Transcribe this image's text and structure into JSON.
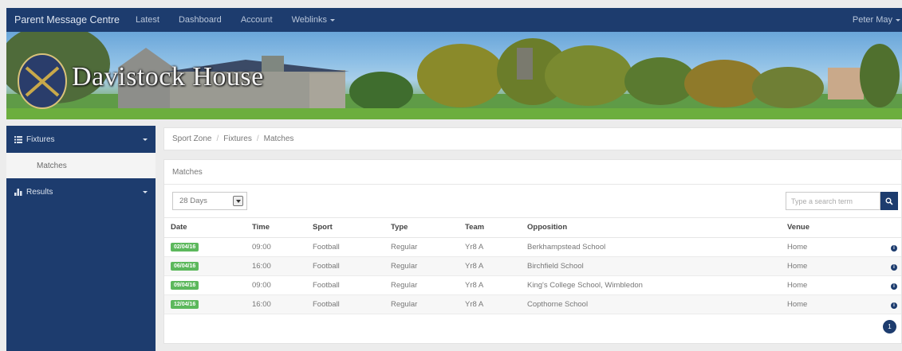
{
  "navbar": {
    "brand": "Parent Message Centre",
    "links": [
      "Latest",
      "Dashboard",
      "Account",
      "Weblinks"
    ],
    "user": "Peter May"
  },
  "banner": {
    "school_name": "Davistock House"
  },
  "sidebar": {
    "items": [
      {
        "label": "Fixtures",
        "icon": "list-icon",
        "expanded": true,
        "subitems": [
          "Matches"
        ]
      },
      {
        "label": "Results",
        "icon": "bar-chart-icon",
        "expanded": false
      }
    ]
  },
  "breadcrumb": [
    "Sport Zone",
    "Fixtures",
    "Matches"
  ],
  "panel": {
    "title": "Matches",
    "range_select": "28 Days",
    "search_placeholder": "Type a search term",
    "columns": [
      "Date",
      "Time",
      "Sport",
      "Type",
      "Team",
      "Opposition",
      "Venue"
    ],
    "rows": [
      {
        "date": "02/04/16",
        "time": "09:00",
        "sport": "Football",
        "type": "Regular",
        "team": "Yr8 A",
        "opposition": "Berkhampstead School",
        "venue": "Home"
      },
      {
        "date": "06/04/16",
        "time": "16:00",
        "sport": "Football",
        "type": "Regular",
        "team": "Yr8 A",
        "opposition": "Birchfield School",
        "venue": "Home"
      },
      {
        "date": "09/04/16",
        "time": "09:00",
        "sport": "Football",
        "type": "Regular",
        "team": "Yr8 A",
        "opposition": "King's College School, Wimbledon",
        "venue": "Home"
      },
      {
        "date": "12/04/16",
        "time": "16:00",
        "sport": "Football",
        "type": "Regular",
        "team": "Yr8 A",
        "opposition": "Copthorne School",
        "venue": "Home"
      }
    ],
    "page": "1"
  },
  "colors": {
    "navy": "#1d3c6e",
    "badge_green": "#5cb85c"
  }
}
